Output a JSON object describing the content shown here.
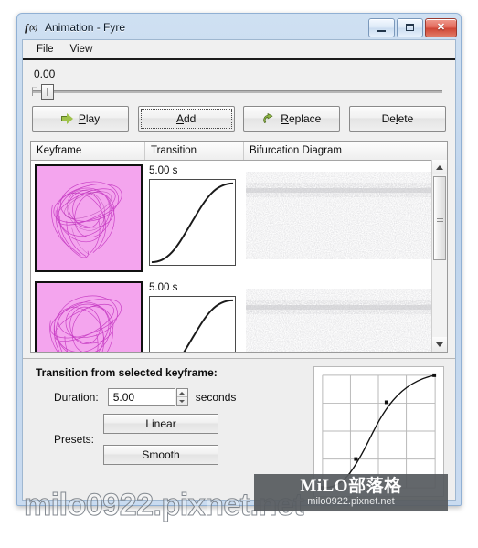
{
  "window": {
    "title": "Animation - Fyre",
    "icon": "function-fx-icon",
    "controls": {
      "minimize": "minimize-icon",
      "maximize": "maximize-icon",
      "close": "✕"
    }
  },
  "menubar": {
    "items": [
      {
        "label": "File"
      },
      {
        "label": "View"
      }
    ]
  },
  "toolbar": {
    "time_readout": "0.00",
    "slider_value": "0.00",
    "buttons": [
      {
        "label_pre": "",
        "mnemonic": "P",
        "label_post": "lay",
        "icon": "play-arrow-icon",
        "focused": false
      },
      {
        "label_pre": "",
        "mnemonic": "A",
        "label_post": "dd",
        "icon": "",
        "focused": true
      },
      {
        "label_pre": "",
        "mnemonic": "R",
        "label_post": "eplace",
        "icon": "replace-arrow-icon",
        "focused": false
      },
      {
        "label_pre": "De",
        "mnemonic": "l",
        "label_post": "ete",
        "icon": "",
        "focused": false
      }
    ]
  },
  "table": {
    "columns": [
      {
        "label": "Keyframe"
      },
      {
        "label": "Transition"
      },
      {
        "label": "Bifurcation Diagram"
      }
    ],
    "rows": [
      {
        "keyframe_thumb": "pink-attractor-fractal",
        "transition_duration": "5.00 s",
        "transition_curve": "smooth-s-curve",
        "bifurcation": "noise-band-diagram",
        "selected": true
      },
      {
        "keyframe_thumb": "pink-attractor-fractal",
        "transition_duration": "5.00 s",
        "transition_curve": "smooth-s-curve",
        "bifurcation": "noise-band-diagram",
        "selected": false
      }
    ]
  },
  "panel": {
    "title": "Transition from selected keyframe:",
    "duration_label": "Duration:",
    "duration_value": "5.00",
    "duration_units": "seconds",
    "presets_label": "Presets:",
    "presets": [
      {
        "label": "Linear"
      },
      {
        "label": "Smooth"
      }
    ],
    "curve_editor": "transition-curve-editor"
  },
  "watermarks": {
    "box_main": "MiLO部落格",
    "box_sub": "milo0922.pixnet.net",
    "big": "milo0922.pixnet.net"
  },
  "colors": {
    "keyframe_fill": "#f4a5ee",
    "keyframe_stroke": "#c12fbe",
    "play_icon": "#9fc24a",
    "close_button": "#cf4434",
    "frame": "#c9dbf0"
  }
}
